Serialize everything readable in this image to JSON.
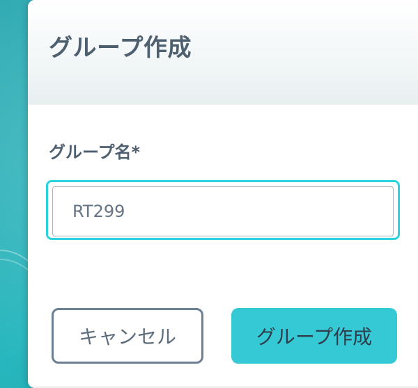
{
  "dialog": {
    "title": "グループ作成"
  },
  "form": {
    "group_name_label": "グループ名*",
    "group_name_value": "RT299",
    "group_name_placeholder": ""
  },
  "actions": {
    "cancel_label": "キャンセル",
    "create_label": "グループ作成"
  },
  "colors": {
    "accent": "#2bd3de",
    "primary_button": "#35c9d5",
    "title_text": "#4e5f6f",
    "cancel_border": "#6b7f92"
  }
}
